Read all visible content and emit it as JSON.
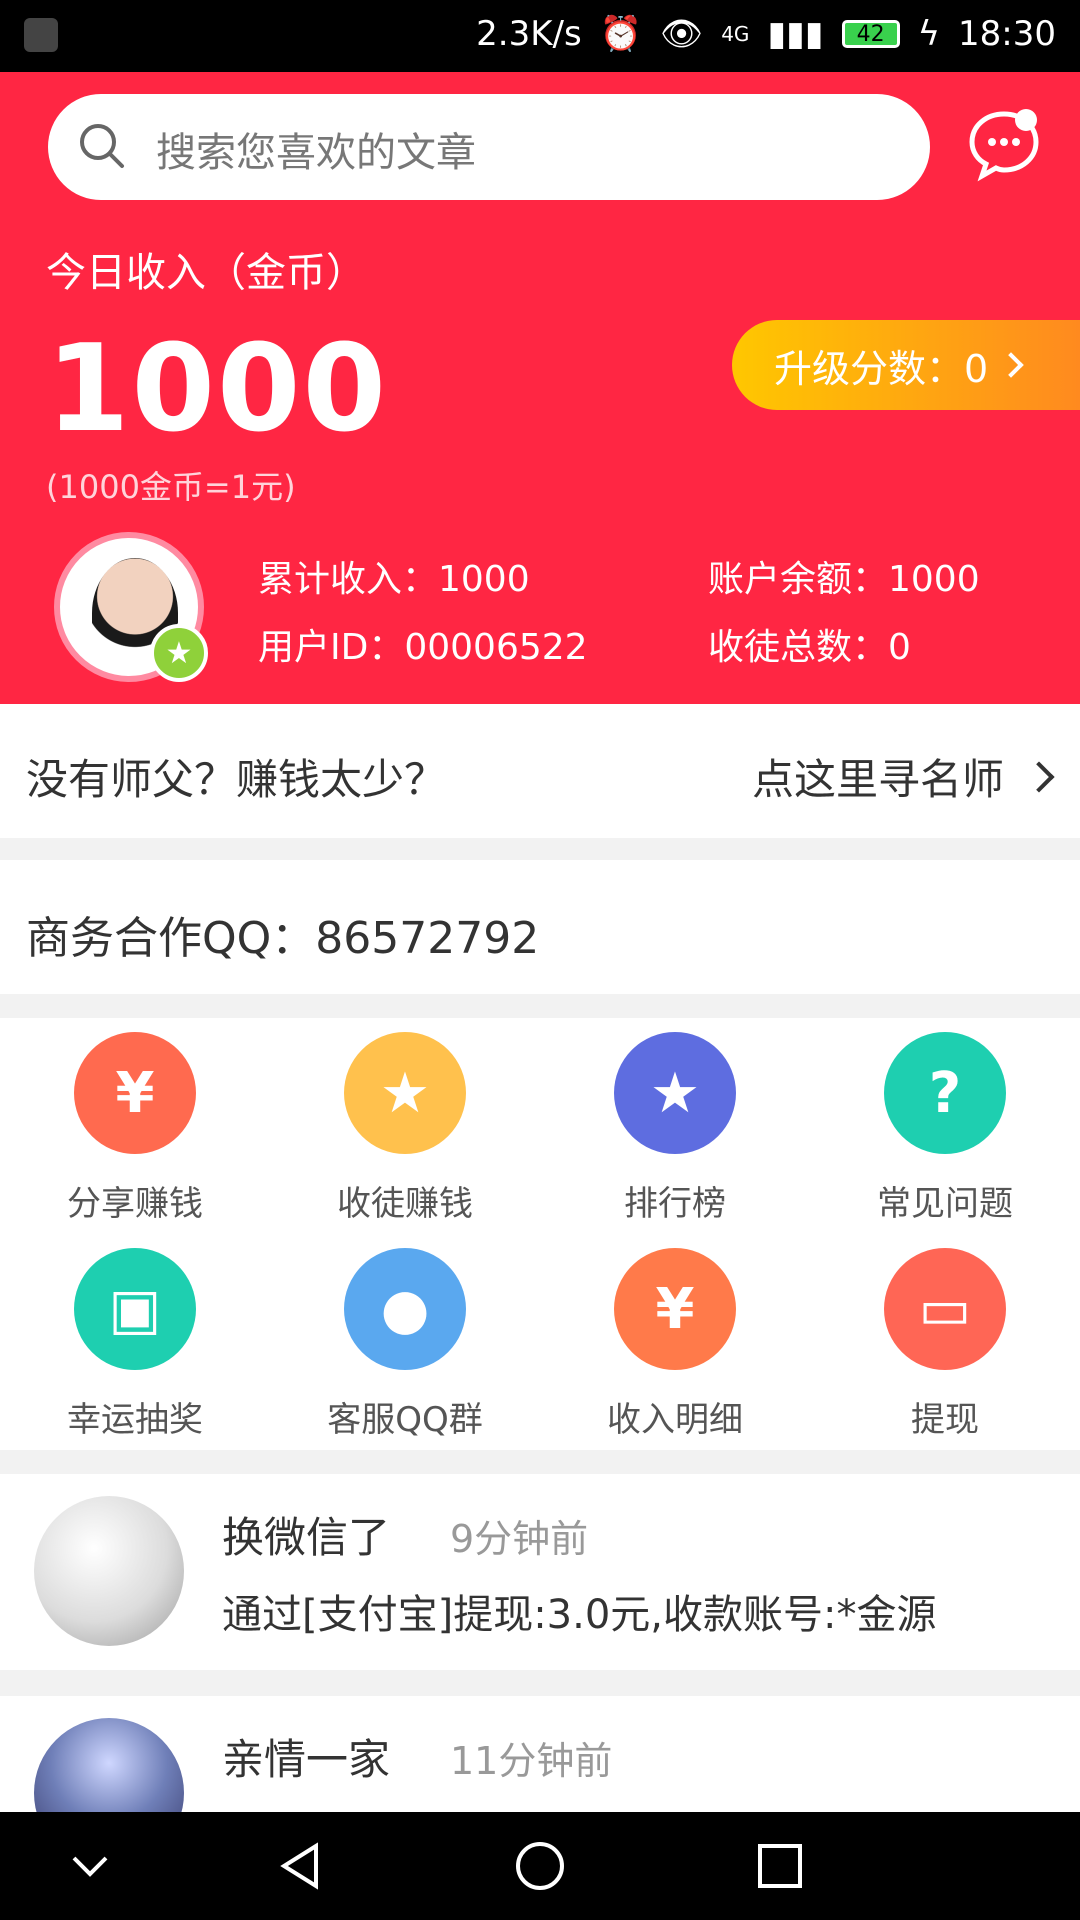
{
  "status_bar": {
    "speed": "2.3K/s",
    "network": "4G",
    "battery": "42",
    "time": "18:30"
  },
  "search": {
    "placeholder": "搜索您喜欢的文章"
  },
  "earnings": {
    "today_label": "今日收入（金币）",
    "today_value": "1000",
    "rate_text": "(1000金币=1元)",
    "upgrade_label": "升级分数：0"
  },
  "user_stats": {
    "total_income": "累计收入：1000",
    "balance": "账户余额：1000",
    "user_id": "用户ID：00006522",
    "apprentice_count": "收徒总数：0"
  },
  "mentor_banner": {
    "left_text": "没有师父？赚钱太少？",
    "right_text": "点这里寻名师"
  },
  "business": {
    "qq_text": "商务合作QQ：86572792"
  },
  "grid_items": [
    {
      "label": "分享赚钱",
      "icon": "money-bag-icon",
      "color": "#ff6a4f",
      "glyph": "¥"
    },
    {
      "label": "收徒赚钱",
      "icon": "user-star-icon",
      "color": "#ffc14d",
      "glyph": "★"
    },
    {
      "label": "排行榜",
      "icon": "medal-icon",
      "color": "#5e6de0",
      "glyph": "★"
    },
    {
      "label": "常见问题",
      "icon": "question-icon",
      "color": "#1ecfb0",
      "glyph": "?"
    },
    {
      "label": "幸运抽奖",
      "icon": "gift-icon",
      "color": "#1ecfb0",
      "glyph": "▣"
    },
    {
      "label": "客服QQ群",
      "icon": "qq-icon",
      "color": "#5aa8ef",
      "glyph": "●"
    },
    {
      "label": "收入明细",
      "icon": "wallet-book-icon",
      "color": "#ff7a4a",
      "glyph": "¥"
    },
    {
      "label": "提现",
      "icon": "wallet-icon",
      "color": "#ff6655",
      "glyph": "▭"
    }
  ],
  "feed": [
    {
      "name": "换微信了",
      "time": "9分钟前",
      "text": "通过[支付宝]提现:3.0元,收款账号:*金源"
    },
    {
      "name": "亲情一家",
      "time": "11分钟前",
      "text": ""
    }
  ]
}
